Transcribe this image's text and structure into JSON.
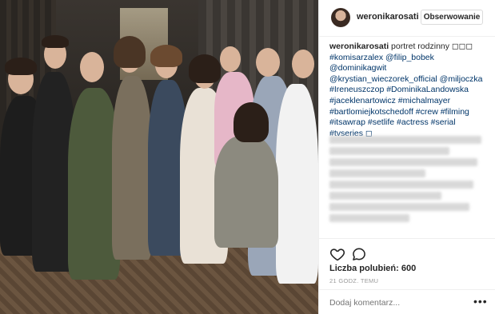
{
  "post": {
    "username": "weronikarosati",
    "follow_label": "Obserwowanie",
    "caption": {
      "username": "weronikarosati",
      "text": " portret rodzinny ◻◻◻",
      "tags": "#komisarzalex @filip_bobek @dominikagwit @krystian_wieczorek_official @miljoczka #Ireneuszczop #DominikaLandowska #jaceklenartowicz #michalmayer #bartlomiejkotschedoff #crew #filming #itsawrap #setlife #actress #serial #tvseries ◻"
    },
    "likes_label": "Liczba polubień: 600",
    "time_label": "21 GODZ. TEMU",
    "comment_placeholder": "Dodaj komentarz...",
    "more_label": "•••"
  },
  "icons": {
    "like": "heart-icon",
    "comment": "comment-icon",
    "more": "more-options-icon"
  }
}
